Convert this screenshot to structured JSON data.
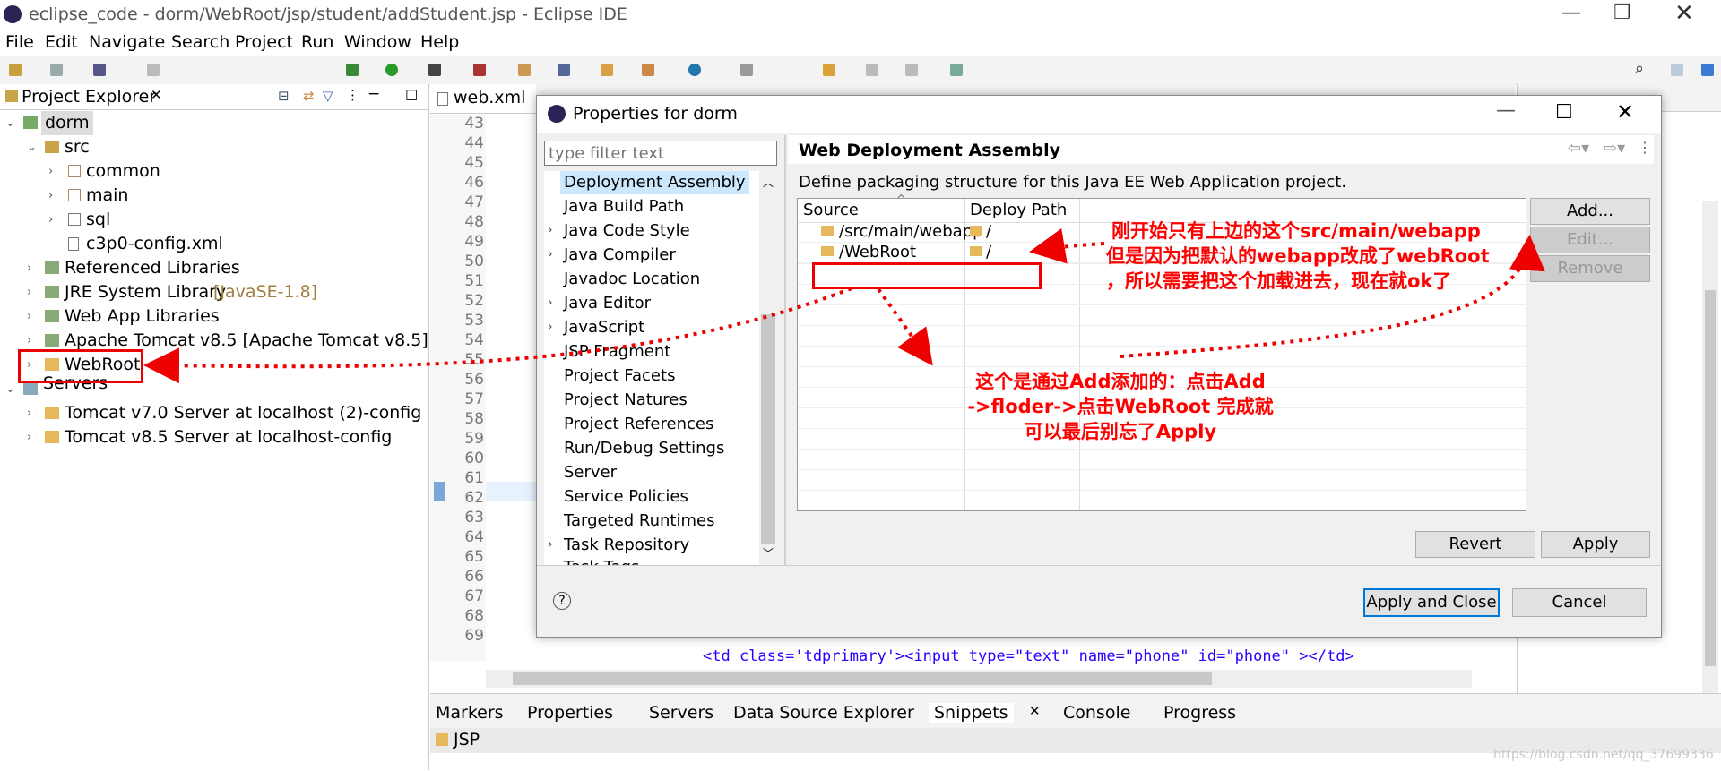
{
  "window": {
    "title": "eclipse_code - dorm/WebRoot/jsp/student/addStudent.jsp - Eclipse IDE"
  },
  "menu": [
    "File",
    "Edit",
    "Navigate",
    "Search",
    "Project",
    "Run",
    "Window",
    "Help"
  ],
  "project_explorer": {
    "title": "Project Explorer",
    "items": [
      "dorm",
      "src",
      "common",
      "main",
      "sql",
      "c3p0-config.xml",
      "Referenced Libraries",
      "JRE System Library",
      "[JavaSE-1.8]",
      "Web App Libraries",
      "Apache Tomcat v8.5 [Apache Tomcat v8.5]",
      "WebRoot",
      "Servers",
      "Tomcat v7.0 Server at localhost (2)-config",
      "Tomcat v8.5 Server at localhost-config"
    ]
  },
  "editor": {
    "tab": "web.xml",
    "lines": [
      "43",
      "44",
      "45",
      "46",
      "47",
      "48",
      "49",
      "50",
      "51",
      "52",
      "53",
      "54",
      "55",
      "56",
      "57",
      "58",
      "59",
      "60",
      "61",
      "62",
      "63",
      "64",
      "65",
      "66",
      "67",
      "68",
      "69"
    ],
    "code_bottom": "<td class='tdprimary'><input type=\"text\" name=\"phone\" id=\"phone\"  ></td>"
  },
  "dialog": {
    "title": "Properties for dorm",
    "filter_placeholder": "type filter text",
    "nav": [
      "Deployment Assembly",
      "Java Build Path",
      "Java Code Style",
      "Java Compiler",
      "Javadoc Location",
      "Java Editor",
      "JavaScript",
      "JSP Fragment",
      "Project Facets",
      "Project Natures",
      "Project References",
      "Run/Debug Settings",
      "Server",
      "Service Policies",
      "Targeted Runtimes",
      "Task Repository",
      "Task Tags"
    ],
    "page_title": "Web Deployment Assembly",
    "description": "Define packaging structure for this Java EE Web Application project.",
    "col_source": "Source",
    "col_deploy": "Deploy Path",
    "rows": [
      {
        "source": "/src/main/webapp",
        "deploy": "/"
      },
      {
        "source": "/WebRoot",
        "deploy": "/"
      }
    ],
    "buttons": {
      "add": "Add...",
      "edit": "Edit...",
      "remove": "Remove",
      "revert": "Revert",
      "apply": "Apply",
      "apply_close": "Apply and Close",
      "cancel": "Cancel",
      "help": "?"
    }
  },
  "annotations": {
    "a1": "刚开始只有上边的这个src/main/webapp",
    "a2": "但是因为把默认的webapp改成了webRoot",
    "a3": "，所以需要把这个加载进去，现在就ok了",
    "b1": "这个是通过Add添加的：点击Add",
    "b2": "->floder->点击WebRoot 完成就",
    "b3": "可以最后别忘了Apply"
  },
  "bottom_tabs": [
    "Markers",
    "Properties",
    "Servers",
    "Data Source Explorer",
    "Snippets",
    "Console",
    "Progress"
  ],
  "bottom_item": "JSP",
  "watermark": "https://blog.csdn.net/qq_37699336",
  "colors": {
    "annotation": "#ff0000",
    "selection": "#cce8ff",
    "jre_label": "#a07e3c"
  }
}
